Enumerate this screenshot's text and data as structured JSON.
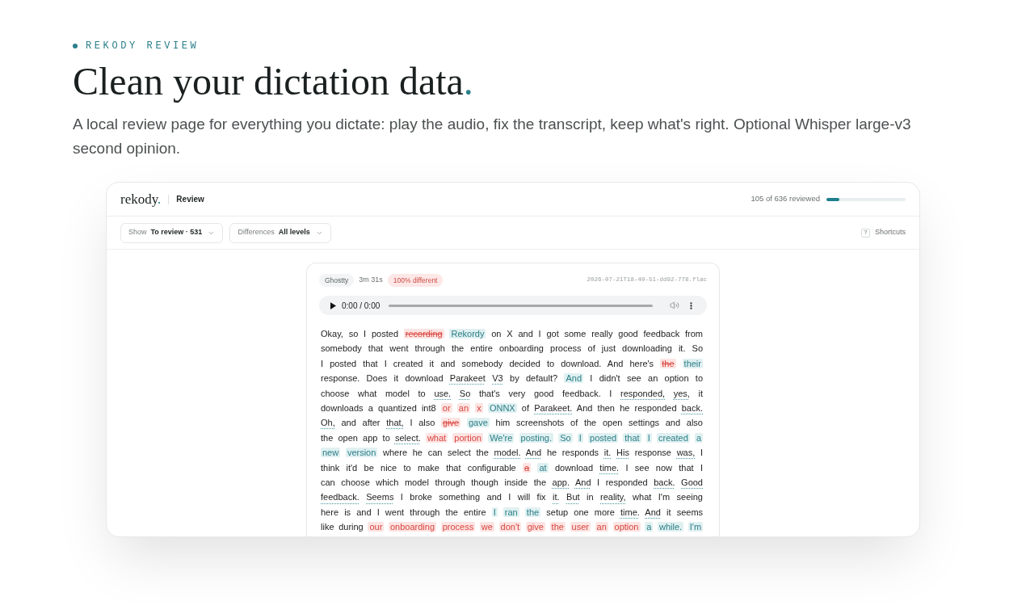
{
  "hero": {
    "eyebrow": "REKODY REVIEW",
    "title": "Clean your dictation data",
    "title_accent": ".",
    "subtitle": "A local review page for everything you dictate: play the audio, fix the transcript, keep what's right. Optional Whisper large-v3 second opinion."
  },
  "app": {
    "logo": {
      "text": "rekody",
      "accent": "."
    },
    "page_title": "Review",
    "progress": {
      "label": "105 of 636 reviewed",
      "level": 0.165
    }
  },
  "filters": [
    {
      "label": "Show",
      "value": "To review · 531"
    },
    {
      "label": "Differences",
      "value": "All levels"
    }
  ],
  "shortcuts": {
    "key": "?",
    "label": "Shortcuts"
  },
  "card": {
    "app": "Ghostty",
    "duration": "3m 31s",
    "difference": "100% different",
    "file": "2026-07-21T18-40-51-dd92-778.flac",
    "player": {
      "time": "0:00 / 0:00"
    },
    "transcript": [
      [
        {
          "text": "Okay, so I posted",
          "kind": "plain"
        },
        {
          "text": "recording",
          "kind": "deleted"
        },
        {
          "text": "Rekordy",
          "kind": "inserted"
        },
        {
          "text": "on X and I got some really good feedback from",
          "kind": "plain"
        }
      ],
      [
        {
          "text": "somebody that went through the entire onboarding process of just downloading it. So",
          "kind": "plain"
        }
      ],
      [
        {
          "text": "I posted that I created it and somebody decided to download. And here's",
          "kind": "plain"
        },
        {
          "text": "the",
          "kind": "deleted"
        },
        {
          "text": "their",
          "kind": "inserted"
        }
      ],
      [
        {
          "text": "response. Does it download",
          "kind": "plain"
        },
        {
          "text": "Parakeet V3",
          "kind": "flagged"
        },
        {
          "text": "by default?",
          "kind": "plain"
        },
        {
          "text": "And",
          "kind": "inserted"
        },
        {
          "text": "I didn't see an option to",
          "kind": "plain"
        }
      ],
      [
        {
          "text": "choose what model to",
          "kind": "plain"
        },
        {
          "text": "use. So",
          "kind": "flagged"
        },
        {
          "text": "that's very good feedback. I",
          "kind": "plain"
        },
        {
          "text": "responded, yes,",
          "kind": "flagged"
        },
        {
          "text": "it",
          "kind": "plain"
        }
      ],
      [
        {
          "text": "downloads a quantized int8",
          "kind": "plain"
        },
        {
          "text": "or an x",
          "kind": "replaced"
        },
        {
          "text": "ONNX",
          "kind": "inserted"
        },
        {
          "text": "of",
          "kind": "plain"
        },
        {
          "text": "Parakeet.",
          "kind": "flagged"
        },
        {
          "text": "And then he responded",
          "kind": "plain"
        },
        {
          "text": "back.",
          "kind": "flagged"
        }
      ],
      [
        {
          "text": "Oh,",
          "kind": "flagged"
        },
        {
          "text": "and after",
          "kind": "plain"
        },
        {
          "text": "that,",
          "kind": "flagged"
        },
        {
          "text": "I also",
          "kind": "plain"
        },
        {
          "text": "give",
          "kind": "deleted"
        },
        {
          "text": "gave",
          "kind": "inserted"
        },
        {
          "text": "him screenshots of the open settings and also",
          "kind": "plain"
        }
      ],
      [
        {
          "text": "the open app to",
          "kind": "plain"
        },
        {
          "text": "select.",
          "kind": "flagged"
        },
        {
          "text": "what portion",
          "kind": "replaced"
        },
        {
          "text": "We're posting. So I posted that I created a",
          "kind": "inserted"
        }
      ],
      [
        {
          "text": "new version",
          "kind": "inserted"
        },
        {
          "text": "where he can select the",
          "kind": "plain"
        },
        {
          "text": "model. And",
          "kind": "flagged"
        },
        {
          "text": "he responds",
          "kind": "plain"
        },
        {
          "text": "it. His",
          "kind": "flagged"
        },
        {
          "text": "response",
          "kind": "plain"
        },
        {
          "text": "was,",
          "kind": "flagged"
        },
        {
          "text": "I",
          "kind": "plain"
        }
      ],
      [
        {
          "text": "think it'd be nice to make that configurable",
          "kind": "plain"
        },
        {
          "text": "a",
          "kind": "deleted"
        },
        {
          "text": "at",
          "kind": "inserted"
        },
        {
          "text": "download",
          "kind": "plain"
        },
        {
          "text": "time.",
          "kind": "flagged"
        },
        {
          "text": "I see now that I",
          "kind": "plain"
        }
      ],
      [
        {
          "text": "can choose which model through though inside the",
          "kind": "plain"
        },
        {
          "text": "app. And",
          "kind": "flagged"
        },
        {
          "text": "I responded",
          "kind": "plain"
        },
        {
          "text": "back. Good",
          "kind": "flagged"
        }
      ],
      [
        {
          "text": "feedback. Seems",
          "kind": "flagged"
        },
        {
          "text": "I broke something and I will fix",
          "kind": "plain"
        },
        {
          "text": "it. But",
          "kind": "flagged"
        },
        {
          "text": "in",
          "kind": "plain"
        },
        {
          "text": "reality,",
          "kind": "flagged"
        },
        {
          "text": "what I'm seeing",
          "kind": "plain"
        }
      ],
      [
        {
          "text": "here is and I went through the entire",
          "kind": "plain"
        },
        {
          "text": "I ran the",
          "kind": "inserted"
        },
        {
          "text": "setup one more",
          "kind": "plain"
        },
        {
          "text": "time. And",
          "kind": "flagged"
        },
        {
          "text": "it seems",
          "kind": "plain"
        }
      ],
      [
        {
          "text": "like during",
          "kind": "plain"
        },
        {
          "text": "our onboarding process we don't give the user an option",
          "kind": "replaced"
        },
        {
          "text": "a while. I'm",
          "kind": "inserted"
        }
      ]
    ]
  }
}
